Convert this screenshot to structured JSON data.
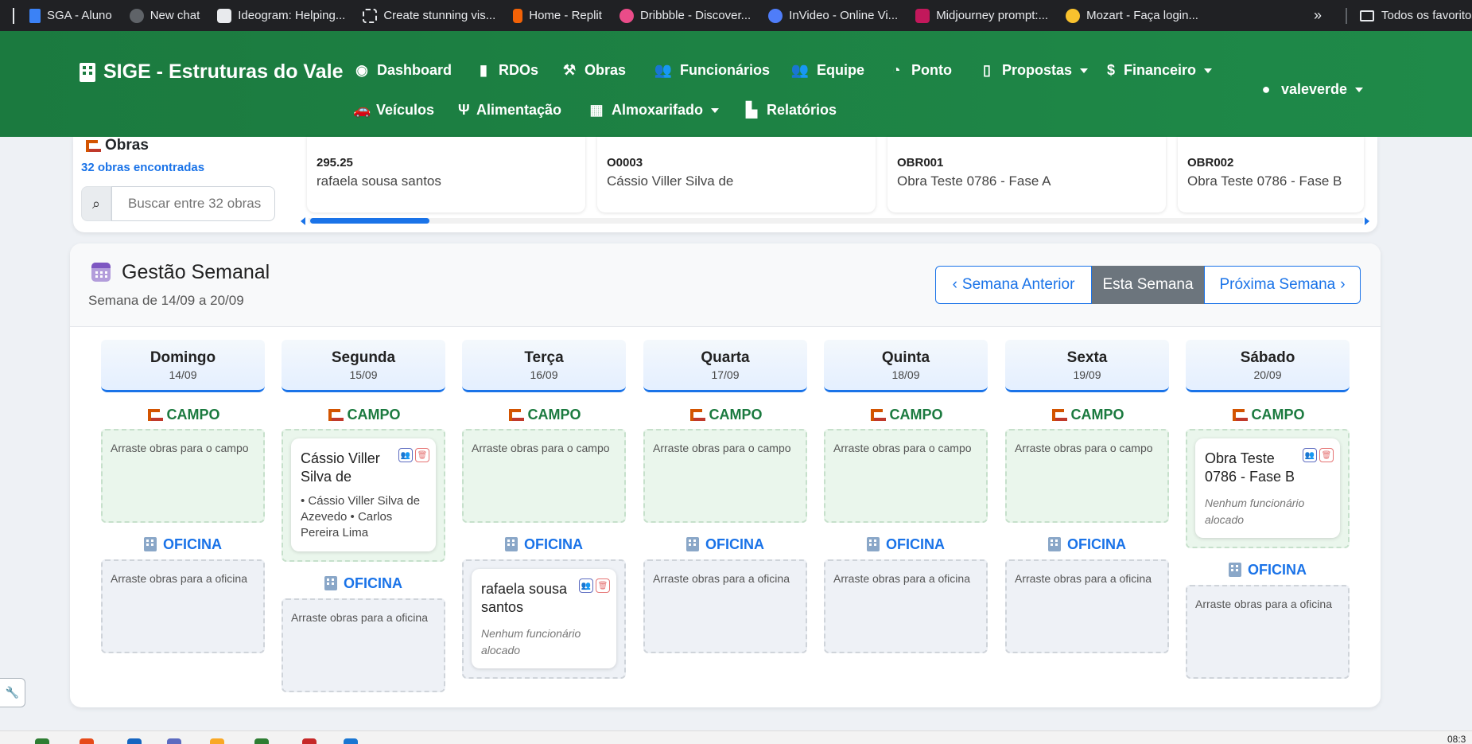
{
  "bookmarks": [
    {
      "label": "SGA - Aluno",
      "color": "#3b82f6"
    },
    {
      "label": "New chat",
      "color": "#9aa0a6"
    },
    {
      "label": "Ideogram: Helping...",
      "color": "#e8eaed"
    },
    {
      "label": "Create stunning vis...",
      "color": "#5f6368"
    },
    {
      "label": "Home - Replit",
      "color": "#f26207"
    },
    {
      "label": "Dribbble - Discover...",
      "color": "#ea4c89"
    },
    {
      "label": "InVideo - Online Vi...",
      "color": "#4f7df9"
    },
    {
      "label": "Midjourney prompt:...",
      "color": "#c2185b"
    },
    {
      "label": "Mozart - Faça login...",
      "color": "#f9c22e"
    }
  ],
  "bookmarks_more": "»",
  "bookmarks_all": "Todos os favoritos",
  "nav": {
    "brand": "SIGE - Estruturas do Vale",
    "items": {
      "dashboard": "Dashboard",
      "rdos": "RDOs",
      "obras": "Obras",
      "funcionarios": "Funcionários",
      "equipe": "Equipe",
      "ponto": "Ponto",
      "propostas": "Propostas",
      "financeiro": "Financeiro",
      "veiculos": "Veículos",
      "alimentacao": "Alimentação",
      "almoxarifado": "Almoxarifado",
      "relatorios": "Relatórios"
    },
    "user": "valeverde"
  },
  "obras": {
    "title": "Obras",
    "count_label": "32 obras encontradas",
    "search_placeholder": "Buscar entre 32 obras",
    "tiles": [
      {
        "code": "295.25",
        "name": "rafaela sousa santos"
      },
      {
        "code": "O0003",
        "name": "Cássio Viller Silva de"
      },
      {
        "code": "OBR001",
        "name": "Obra Teste 0786 - Fase A"
      },
      {
        "code": "OBR002",
        "name": "Obra Teste 0786 - Fase B"
      }
    ]
  },
  "week": {
    "title": "Gestão Semanal",
    "subtitle": "Semana de 14/09 a 20/09",
    "prev": "Semana Anterior",
    "current": "Esta Semana",
    "next": "Próxima Semana",
    "campo_label": "CAMPO",
    "oficina_label": "OFICINA",
    "drop_campo": "Arraste obras para o campo",
    "drop_oficina": "Arraste obras para a oficina",
    "days": [
      {
        "name": "Domingo",
        "date": "14/09"
      },
      {
        "name": "Segunda",
        "date": "15/09"
      },
      {
        "name": "Terça",
        "date": "16/09"
      },
      {
        "name": "Quarta",
        "date": "17/09"
      },
      {
        "name": "Quinta",
        "date": "18/09"
      },
      {
        "name": "Sexta",
        "date": "19/09"
      },
      {
        "name": "Sábado",
        "date": "20/09"
      }
    ],
    "cards": {
      "segunda_campo": {
        "title": "Cássio Viller Silva de",
        "staff": "• Cássio Viller Silva de Azevedo • Carlos Pereira Lima"
      },
      "terca_oficina": {
        "title": "rafaela sousa santos",
        "staff": "Nenhum funcionário alocado"
      },
      "sabado_campo": {
        "title": "Obra Teste 0786 - Fase B",
        "staff": "Nenhum funcionário alocado"
      }
    }
  },
  "taskbar_time": "08:3"
}
